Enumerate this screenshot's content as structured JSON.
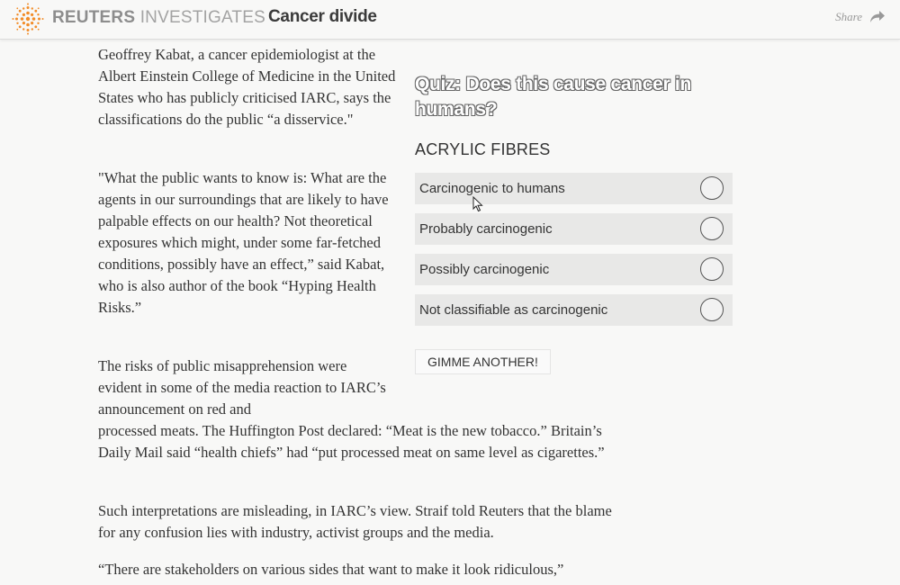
{
  "header": {
    "brand_bold": "REUTERS",
    "brand_light": "INVESTIGATES",
    "section_title": "Cancer divide",
    "share_label": "Share",
    "logo_icon": "reuters-logo-icon",
    "share_icon": "share-arrow-icon"
  },
  "article": {
    "p1": "Geoffrey Kabat, a cancer epidemiologist at the Albert Einstein College of Medicine in the United States who has publicly criticised IARC, says the classifications do the public “a disservice.\"",
    "p2": "\"What the public wants to know is: What are the agents in our surroundings that are likely to have palpable effects on our health? Not theoretical exposures which might, under some far-fetched conditions, possibly have an effect,” said Kabat, who is also author of the book “Hyping Health Risks.”",
    "p3a": "The risks of public misapprehension were evident in some of the media reaction to IARC’s announcement on red and",
    "p3b": "processed meats. The Huffington Post declared: “Meat is the new tobacco.” Britain’s Daily Mail said “health chiefs” had “put processed meat on same level as cigarettes.”",
    "p4": "Such interpretations are misleading, in IARC’s view. Straif told Reuters that the blame for any confusion lies with industry, activist groups and the media.",
    "p5": "“There are stakeholders on various sides that want to make it look ridiculous,”"
  },
  "quiz": {
    "title": "Quiz: Does this cause cancer in humans?",
    "subject": "ACRYLIC FIBRES",
    "options": [
      {
        "label": "Carcinogenic to humans"
      },
      {
        "label": "Probably carcinogenic"
      },
      {
        "label": "Possibly carcinogenic"
      },
      {
        "label": "Not classifiable as carcinogenic"
      }
    ],
    "next_button": "GIMME ANOTHER!"
  },
  "colors": {
    "background": "#f8f8f7",
    "option_bg": "#e8e8e7",
    "logo_orange": "#f28c28",
    "text": "#333333"
  }
}
